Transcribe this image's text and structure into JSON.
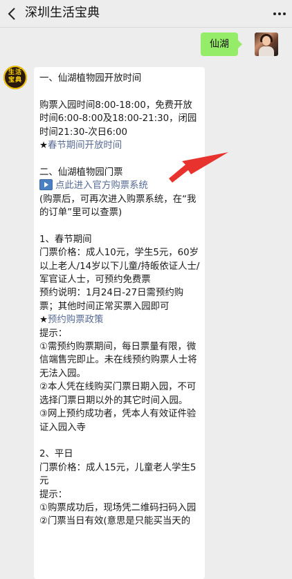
{
  "header": {
    "title": "深圳生活宝典"
  },
  "chat": {
    "user_message": "仙湖",
    "bot_avatar_text": "生活\n宝典",
    "bot_message": {
      "lines": [
        {
          "text": "一、仙湖植物园开放时间",
          "type": "text"
        },
        {
          "text": "",
          "type": "gap"
        },
        {
          "text": "购票入园时间8:00-18:00，免费开放时间6:00-8:00及18:00-21:30，闭园时间21:30-次日6:00",
          "type": "text"
        },
        {
          "star": "★",
          "text": "春节期间开放时间",
          "type": "link"
        },
        {
          "text": "",
          "type": "gap"
        },
        {
          "text": "二、仙湖植物园门票",
          "type": "text"
        },
        {
          "text": "点此进入官方购票系统",
          "type": "play-link"
        },
        {
          "text": "(购票后，可再次进入购票系统，在“我的订单”里可以查票)",
          "type": "text"
        },
        {
          "text": "",
          "type": "gap"
        },
        {
          "text": "1、春节期间",
          "type": "text"
        },
        {
          "text": "门票价格：成人10元，学生5元，60岁以上老人/14岁以下儿童/持皈依证人士/军官证人士，可预约免费票",
          "type": "text"
        },
        {
          "text": "预约说明：1月24日-27日需预约购票；其他时间正常买票入园即可",
          "type": "text"
        },
        {
          "star": "★",
          "text": "预约购票政策",
          "type": "link"
        },
        {
          "text": "提示：",
          "type": "text"
        },
        {
          "text": "①需预约购票期间，每日票量有限，微信端售完即止。未在线预约购票人士将无法入园。",
          "type": "text"
        },
        {
          "text": "②本人凭在线购买门票日期入园，不可选择门票日期以外的其它时间入园。",
          "type": "text"
        },
        {
          "text": "③网上预约成功者，凭本人有效证件验证入园入寺",
          "type": "text"
        },
        {
          "text": "",
          "type": "gap"
        },
        {
          "text": "2、平日",
          "type": "text"
        },
        {
          "text": "门票价格：成人15元，儿童老人学生5元",
          "type": "text"
        },
        {
          "text": "提示：",
          "type": "text"
        },
        {
          "text": "①购票成功后，现场凭二维码扫码入园",
          "type": "text"
        },
        {
          "text": "②门票当日有效(意思是只能买当天的",
          "type": "text"
        }
      ]
    }
  },
  "colors": {
    "bubble_green": "#95ec69",
    "link": "#576b95",
    "arrow": "#e8322d",
    "background": "#ededed"
  },
  "icons": [
    "back-arrow-icon",
    "more-dots-icon",
    "play-icon"
  ]
}
